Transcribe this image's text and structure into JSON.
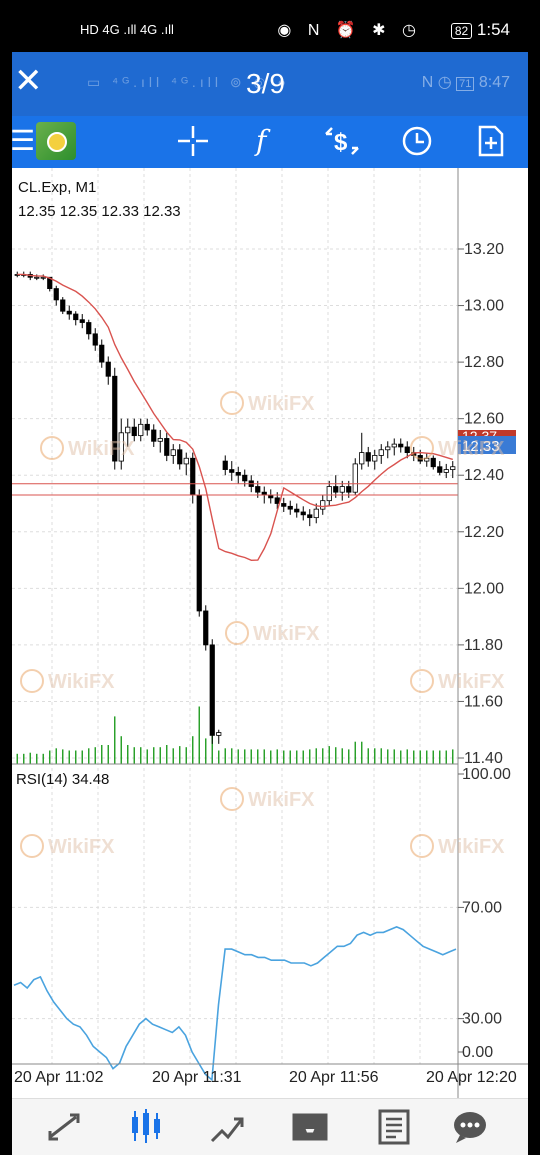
{
  "status_bar": {
    "left_text": "HD  4G .ıll  4G .ıll",
    "right_icons": "◉ N ⏰ ✱ ◷",
    "battery": "82",
    "time": "1:54"
  },
  "viewer": {
    "counter": "3/9",
    "inner_time": "8:47",
    "inner_battery": "71"
  },
  "toolbar": {
    "icons": [
      "menu-icon",
      "app-logo",
      "crosshair-icon",
      "function-icon",
      "trade-icon",
      "clock-icon",
      "add-object-icon"
    ]
  },
  "chart": {
    "symbol_label": "CL.Exp, M1",
    "ohlc_label": "12.35 12.35 12.33 12.33",
    "current_price": "12.33",
    "hidden_price": "12.37",
    "rsi_label": "RSI(14) 34.48",
    "price_ticks": [
      "13.20",
      "13.00",
      "12.80",
      "12.60",
      "12.40",
      "12.20",
      "12.00",
      "11.80",
      "11.60",
      "11.40"
    ],
    "rsi_ticks": [
      "100.00",
      "70.00",
      "30.00",
      "0.00"
    ],
    "time_ticks": [
      "20 Apr 11:02",
      "20 Apr 11:31",
      "20 Apr 11:56",
      "20 Apr 12:20"
    ],
    "watermark": "WikiFX"
  },
  "chart_data": {
    "type": "candlestick",
    "symbol": "CL.Exp",
    "timeframe": "M1",
    "ylim": [
      11.4,
      13.2
    ],
    "candles": [
      [
        13.11,
        13.12,
        13.1,
        13.11
      ],
      [
        13.11,
        13.12,
        13.1,
        13.11
      ],
      [
        13.11,
        13.12,
        13.09,
        13.1
      ],
      [
        13.1,
        13.11,
        13.09,
        13.1
      ],
      [
        13.1,
        13.11,
        13.09,
        13.1
      ],
      [
        13.1,
        13.1,
        13.05,
        13.06
      ],
      [
        13.06,
        13.07,
        13.0,
        13.02
      ],
      [
        13.02,
        13.03,
        12.97,
        12.98
      ],
      [
        12.98,
        13.0,
        12.95,
        12.97
      ],
      [
        12.97,
        12.98,
        12.93,
        12.95
      ],
      [
        12.95,
        12.97,
        12.92,
        12.94
      ],
      [
        12.94,
        12.95,
        12.88,
        12.9
      ],
      [
        12.9,
        12.92,
        12.84,
        12.86
      ],
      [
        12.86,
        12.88,
        12.78,
        12.8
      ],
      [
        12.8,
        12.82,
        12.72,
        12.75
      ],
      [
        12.75,
        12.78,
        12.42,
        12.45
      ],
      [
        12.45,
        12.6,
        12.42,
        12.55
      ],
      [
        12.55,
        12.6,
        12.5,
        12.57
      ],
      [
        12.57,
        12.6,
        12.52,
        12.54
      ],
      [
        12.54,
        12.6,
        12.52,
        12.58
      ],
      [
        12.58,
        12.6,
        12.54,
        12.56
      ],
      [
        12.56,
        12.58,
        12.5,
        12.52
      ],
      [
        12.52,
        12.56,
        12.48,
        12.53
      ],
      [
        12.53,
        12.55,
        12.45,
        12.47
      ],
      [
        12.47,
        12.51,
        12.44,
        12.49
      ],
      [
        12.49,
        12.51,
        12.42,
        12.44
      ],
      [
        12.44,
        12.48,
        12.4,
        12.46
      ],
      [
        12.46,
        12.48,
        12.3,
        12.33
      ],
      [
        12.33,
        12.35,
        11.9,
        11.92
      ],
      [
        11.92,
        11.94,
        11.78,
        11.8
      ],
      [
        11.8,
        11.82,
        11.45,
        11.48
      ],
      [
        11.48,
        11.5,
        11.45,
        11.49
      ],
      [
        12.45,
        12.47,
        12.4,
        12.42
      ],
      [
        12.42,
        12.45,
        12.38,
        12.41
      ],
      [
        12.41,
        12.43,
        12.37,
        12.4
      ],
      [
        12.4,
        12.42,
        12.36,
        12.38
      ],
      [
        12.38,
        12.4,
        12.34,
        12.36
      ],
      [
        12.36,
        12.38,
        12.32,
        12.34
      ],
      [
        12.34,
        12.36,
        12.3,
        12.33
      ],
      [
        12.33,
        12.35,
        12.3,
        12.32
      ],
      [
        12.32,
        12.34,
        12.28,
        12.3
      ],
      [
        12.3,
        12.32,
        12.27,
        12.29
      ],
      [
        12.29,
        12.31,
        12.26,
        12.28
      ],
      [
        12.28,
        12.3,
        12.25,
        12.27
      ],
      [
        12.27,
        12.29,
        12.24,
        12.26
      ],
      [
        12.26,
        12.28,
        12.22,
        12.25
      ],
      [
        12.25,
        12.3,
        12.23,
        12.28
      ],
      [
        12.28,
        12.33,
        12.26,
        12.31
      ],
      [
        12.31,
        12.38,
        12.29,
        12.36
      ],
      [
        12.36,
        12.4,
        12.32,
        12.34
      ],
      [
        12.34,
        12.38,
        12.31,
        12.36
      ],
      [
        12.36,
        12.38,
        12.32,
        12.34
      ],
      [
        12.34,
        12.46,
        12.33,
        12.44
      ],
      [
        12.44,
        12.55,
        12.42,
        12.48
      ],
      [
        12.48,
        12.5,
        12.43,
        12.45
      ],
      [
        12.45,
        12.49,
        12.42,
        12.47
      ],
      [
        12.47,
        12.51,
        12.44,
        12.49
      ],
      [
        12.49,
        12.52,
        12.46,
        12.5
      ],
      [
        12.5,
        12.53,
        12.47,
        12.51
      ],
      [
        12.51,
        12.53,
        12.48,
        12.5
      ],
      [
        12.5,
        12.52,
        12.46,
        12.48
      ],
      [
        12.48,
        12.5,
        12.45,
        12.47
      ],
      [
        12.47,
        12.49,
        12.44,
        12.45
      ],
      [
        12.45,
        12.48,
        12.43,
        12.46
      ],
      [
        12.46,
        12.47,
        12.42,
        12.43
      ],
      [
        12.43,
        12.45,
        12.4,
        12.41
      ],
      [
        12.41,
        12.44,
        12.39,
        12.42
      ],
      [
        12.42,
        12.45,
        12.39,
        12.43
      ]
    ],
    "rsi": [
      42,
      43,
      41,
      44,
      45,
      40,
      36,
      33,
      30,
      28,
      27,
      24,
      20,
      18,
      16,
      12,
      14,
      20,
      24,
      28,
      30,
      28,
      27,
      26,
      25,
      27,
      24,
      18,
      14,
      10,
      8,
      35,
      55,
      55,
      54,
      53,
      53,
      52,
      52,
      51,
      51,
      51,
      50,
      50,
      50,
      49,
      50,
      52,
      54,
      56,
      56,
      57,
      60,
      61,
      60,
      61,
      61,
      62,
      63,
      62,
      60,
      58,
      56,
      55,
      54,
      53,
      54,
      55
    ],
    "rsi_period": 14,
    "rsi_ylim": [
      0,
      100
    ],
    "rsi_levels": [
      30,
      70
    ]
  },
  "colors": {
    "accent_blue": "#1a73e8",
    "candle": "#000000",
    "ma_line": "#d9534f",
    "price_line": "#d9534f",
    "price_tag": "#3a7bd5",
    "volume": "#1f9b1f",
    "rsi_line": "#4aa3df",
    "grid": "#c8c8c8"
  },
  "bottom_nav": {
    "icons": [
      "quotes-icon",
      "chart-icon",
      "trade-icon",
      "history-icon",
      "news-icon",
      "chat-icon"
    ]
  }
}
